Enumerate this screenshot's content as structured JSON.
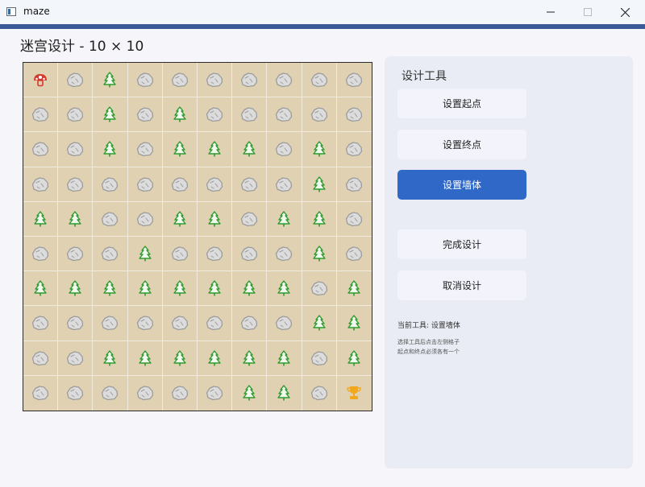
{
  "window": {
    "title": "maze",
    "accent_color": "#3a5a98"
  },
  "heading": "迷宫设计 - 10 × 10",
  "maze": {
    "rows": 10,
    "cols": 10,
    "legend": {
      "S": "start-icon",
      "E": "end-icon",
      "W": "rock-wall-icon",
      "P": "tree-path-icon"
    },
    "grid": [
      [
        "S",
        "W",
        "P",
        "W",
        "W",
        "W",
        "W",
        "W",
        "W",
        "W"
      ],
      [
        "W",
        "W",
        "P",
        "W",
        "P",
        "W",
        "W",
        "W",
        "W",
        "W"
      ],
      [
        "W",
        "W",
        "P",
        "W",
        "P",
        "P",
        "P",
        "W",
        "P",
        "W"
      ],
      [
        "W",
        "W",
        "W",
        "W",
        "W",
        "W",
        "W",
        "W",
        "P",
        "W"
      ],
      [
        "P",
        "P",
        "W",
        "W",
        "P",
        "P",
        "W",
        "P",
        "P",
        "W"
      ],
      [
        "W",
        "W",
        "W",
        "P",
        "W",
        "W",
        "W",
        "W",
        "P",
        "W"
      ],
      [
        "P",
        "P",
        "P",
        "P",
        "P",
        "P",
        "P",
        "P",
        "W",
        "P"
      ],
      [
        "W",
        "W",
        "W",
        "W",
        "W",
        "W",
        "W",
        "W",
        "P",
        "P"
      ],
      [
        "W",
        "W",
        "P",
        "P",
        "P",
        "P",
        "P",
        "P",
        "W",
        "P"
      ],
      [
        "W",
        "W",
        "W",
        "W",
        "W",
        "W",
        "P",
        "P",
        "W",
        "E"
      ]
    ],
    "colors": {
      "cell_bg": "#dfd1b1",
      "start": "#d63a2e",
      "end": "#f2a81d",
      "tree": "#2f9a2f",
      "rock": "#9c9c9c"
    }
  },
  "panel": {
    "title": "设计工具",
    "buttons": {
      "set_start": "设置起点",
      "set_end": "设置终点",
      "set_wall": "设置墙体",
      "finish": "完成设计",
      "cancel": "取消设计"
    },
    "active_color": "#3068c8",
    "current_tool": "当前工具: 设置墙体",
    "hint_line1": "选择工具后点击左侧格子",
    "hint_line2": "起点和终点必须各有一个"
  }
}
